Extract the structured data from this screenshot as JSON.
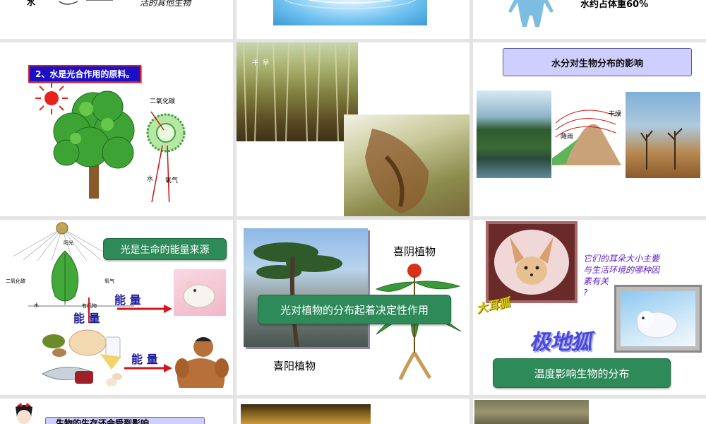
{
  "slides": {
    "s1": {
      "partial_label": "水",
      "partial_text": "活的其他生物"
    },
    "s3": {
      "partial_text": "水约占体重60%"
    },
    "s4": {
      "label": "2、水是光合作用的原料。",
      "co2": "二氧化碳",
      "water": "水",
      "oxygen": "氧气"
    },
    "s5": {
      "caption": "干旱"
    },
    "s6": {
      "title": "水分对生物分布的影响",
      "dry": "干燥",
      "rain": "降雨"
    },
    "s7": {
      "button": "光是生命的能量来源",
      "sunlight": "阳光",
      "co2": "二氧化碳",
      "oxygen": "氧气",
      "water": "水",
      "organic": "有机物",
      "energy1": "能 量",
      "energy2": "能 量",
      "energy3": "能 量"
    },
    "s8": {
      "button": "光对植物的分布起着决定性作用",
      "shade": "喜阴植物",
      "sun": "喜阳植物"
    },
    "s9": {
      "question": [
        "它们的耳朵大小主要",
        "与生活环境的哪种因",
        "素有关",
        "?"
      ],
      "fennec": "大耳狐",
      "arctic": "极地狐",
      "button": "温度影响生物的分布"
    },
    "s10": {
      "banner": "生物的生存还会受到影响"
    }
  },
  "colors": {
    "accent_green": "#2f8a5a",
    "label_blue": "#1b10c8",
    "label_red": "#d91c2c",
    "energy_red": "#d6141a",
    "lavender": "#cfcfff"
  }
}
